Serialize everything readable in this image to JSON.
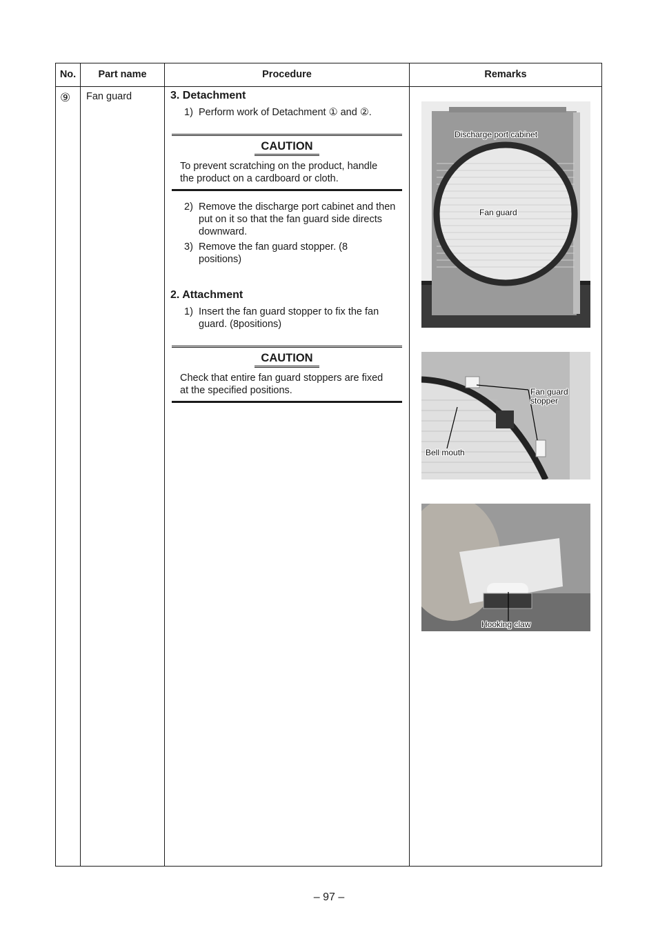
{
  "table": {
    "headers": {
      "no": "No.",
      "part_name": "Part name",
      "procedure": "Procedure",
      "remarks": "Remarks"
    },
    "row": {
      "no": "⑨",
      "part_name": "Fan guard",
      "procedure": {
        "sections": [
          {
            "title": "3. Detachment",
            "steps_before_caution": [
              {
                "num": "1)",
                "text": "Perform work of Detachment ① and ②."
              }
            ],
            "caution": {
              "title": "CAUTION",
              "text": "To prevent scratching on the product, handle the product on a cardboard or cloth."
            },
            "steps_after_caution": [
              {
                "num": "2)",
                "text": "Remove the discharge port cabinet and then put on it so that the fan guard side directs downward."
              },
              {
                "num": "3)",
                "text": "Remove the fan guard stopper. (8 positions)"
              }
            ]
          },
          {
            "title": "2. Attachment",
            "steps_before_caution": [
              {
                "num": "1)",
                "text": "Insert the fan guard stopper to fix the fan guard. (8positions)"
              }
            ],
            "caution": {
              "title": "CAUTION",
              "text": "Check that entire fan guard stoppers are fixed at the specified positions."
            }
          }
        ]
      },
      "remarks": {
        "photos": [
          {
            "name": "discharge-port-cabinet-photo",
            "labels": [
              "Discharge port cabinet",
              "Fan guard"
            ]
          },
          {
            "name": "fan-guard-stopper-photo",
            "labels": [
              "Fan guard stopper",
              "Bell mouth"
            ]
          },
          {
            "name": "hooking-claw-photo",
            "labels": [
              "Hooking claw"
            ]
          }
        ]
      }
    }
  },
  "footer": {
    "page_number": "– 97 –"
  }
}
